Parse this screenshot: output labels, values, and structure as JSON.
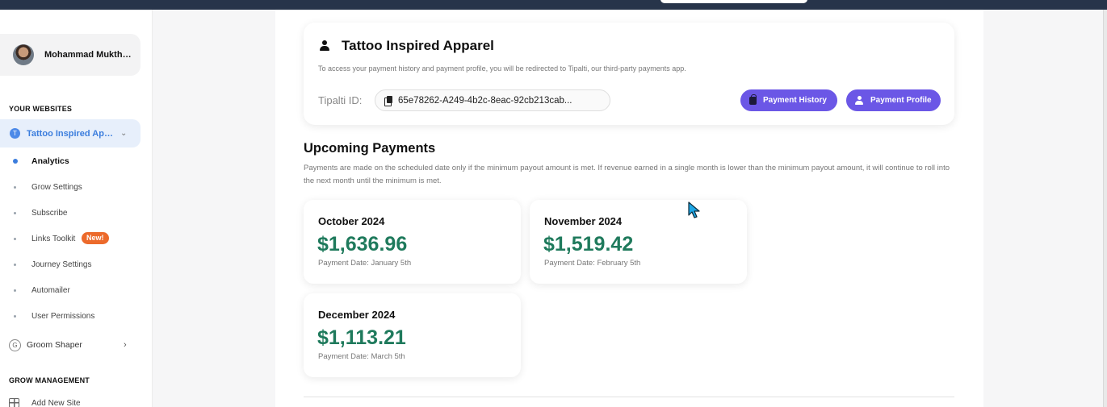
{
  "user": {
    "name": "Mohammad Mukthe..."
  },
  "sidebar": {
    "section_websites": "YOUR WEBSITES",
    "active_site": {
      "badge": "T",
      "label": "Tattoo Inspired Appa..."
    },
    "items": [
      {
        "label": "Analytics"
      },
      {
        "label": "Grow Settings"
      },
      {
        "label": "Subscribe"
      },
      {
        "label": "Links Toolkit",
        "badge": "New!"
      },
      {
        "label": "Journey Settings"
      },
      {
        "label": "Automailer"
      },
      {
        "label": "User Permissions"
      }
    ],
    "other_site": {
      "badge": "G",
      "label": "Groom Shaper"
    },
    "section_grow": "GROW MANAGEMENT",
    "add_site": "Add New Site"
  },
  "profile": {
    "title": "Tattoo Inspired Apparel",
    "description": "To access your payment history and payment profile, you will be redirected to Tipalti, our third-party payments app.",
    "tipalti_label": "Tipalti ID:",
    "tipalti_id": "65e78262-A249-4b2c-8eac-92cb213cab...",
    "btn_history": "Payment History",
    "btn_profile": "Payment Profile"
  },
  "upcoming": {
    "title": "Upcoming Payments",
    "description": "Payments are made on the scheduled date only if the minimum payout amount is met. If revenue earned in a single month is lower than the minimum payout amount, it will continue to roll into the next month until the minimum is met.",
    "payments": [
      {
        "month": "October 2024",
        "amount": "$1,636.96",
        "date": "Payment Date: January 5th"
      },
      {
        "month": "November 2024",
        "amount": "$1,519.42",
        "date": "Payment Date: February 5th"
      },
      {
        "month": "December 2024",
        "amount": "$1,113.21",
        "date": "Payment Date: March 5th"
      }
    ]
  },
  "colors": {
    "accent": "#6b57e6",
    "amount": "#1f7a5c",
    "active_nav": "#3b7ddd",
    "new_badge": "#ec6a2b"
  }
}
